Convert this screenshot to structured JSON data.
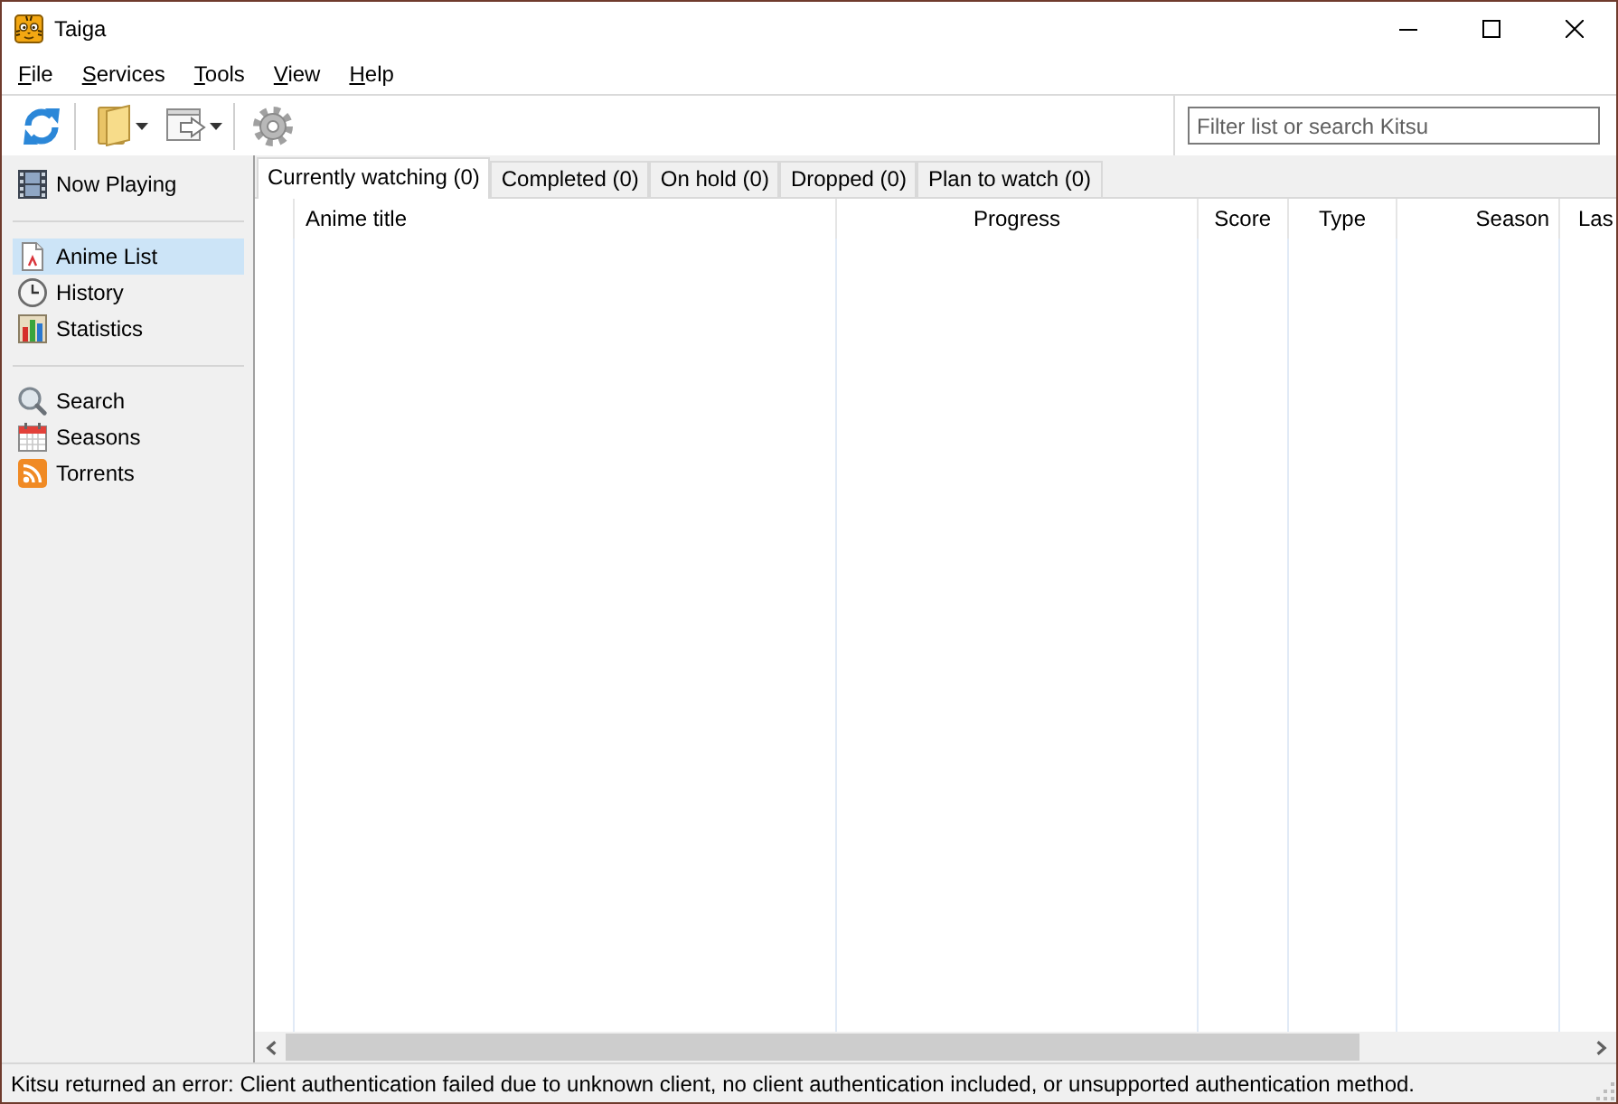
{
  "window": {
    "title": "Taiga"
  },
  "menu": [
    "File",
    "Services",
    "Tools",
    "View",
    "Help"
  ],
  "toolbar": {
    "search": {
      "placeholder": "Filter list or search Kitsu"
    }
  },
  "sidebar": {
    "sections": [
      {
        "items": [
          {
            "label": "Now Playing",
            "selected": false
          }
        ]
      },
      {
        "items": [
          {
            "label": "Anime List",
            "selected": true
          },
          {
            "label": "History",
            "selected": false
          },
          {
            "label": "Statistics",
            "selected": false
          }
        ]
      },
      {
        "items": [
          {
            "label": "Search",
            "selected": false
          },
          {
            "label": "Seasons",
            "selected": false
          },
          {
            "label": "Torrents",
            "selected": false
          }
        ]
      }
    ]
  },
  "tabs": [
    {
      "label": "Currently watching (0)",
      "selected": true
    },
    {
      "label": "Completed (0)",
      "selected": false
    },
    {
      "label": "On hold (0)",
      "selected": false
    },
    {
      "label": "Dropped (0)",
      "selected": false
    },
    {
      "label": "Plan to watch (0)",
      "selected": false
    }
  ],
  "table": {
    "columns": [
      "Anime title",
      "Progress",
      "Score",
      "Type",
      "Season",
      "Las"
    ]
  },
  "status_bar": {
    "text": "Kitsu returned an error: Client authentication failed due to unknown client, no client authentication included, or unsupported authentication method."
  }
}
